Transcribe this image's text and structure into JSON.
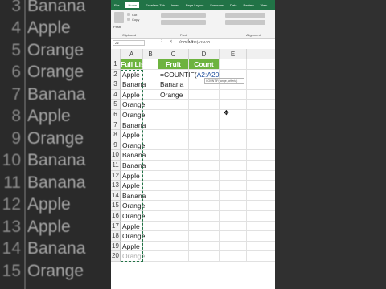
{
  "background_left_rows": [
    {
      "num": "3",
      "text": "Banana"
    },
    {
      "num": "4",
      "text": "Apple"
    },
    {
      "num": "5",
      "text": "Orange"
    },
    {
      "num": "6",
      "text": "Orange"
    },
    {
      "num": "7",
      "text": "Banana"
    },
    {
      "num": "8",
      "text": "Apple"
    },
    {
      "num": "9",
      "text": "Orange"
    },
    {
      "num": "10",
      "text": "Banana"
    },
    {
      "num": "11",
      "text": "Banana"
    },
    {
      "num": "12",
      "text": "Apple"
    },
    {
      "num": "13",
      "text": "Apple"
    },
    {
      "num": "14",
      "text": "Banana"
    },
    {
      "num": "15",
      "text": "Orange"
    }
  ],
  "ribbon": {
    "tabs": [
      "File",
      "Home",
      "Excellent Tab",
      "Insert",
      "Page Layout",
      "Formulas",
      "Data",
      "Review",
      "View"
    ],
    "active_tab": "Home",
    "paste_label": "Paste",
    "cut_label": "Cut",
    "copy_label": "Copy",
    "clipboard_label": "Clipboard",
    "font_label": "Font",
    "alignment_label": "Alignment"
  },
  "formula_bar": {
    "name_box": "A2",
    "formula": "=COUNTIF(A2:A20"
  },
  "columns": [
    "A",
    "B",
    "C",
    "D",
    "E"
  ],
  "rows": [
    "1",
    "2",
    "3",
    "4",
    "5",
    "6",
    "7",
    "8",
    "9",
    "10",
    "11",
    "12",
    "13",
    "14",
    "15",
    "16",
    "17",
    "18",
    "19",
    "20"
  ],
  "sheet": {
    "col_a_header": "Full List",
    "col_c_header": "Fruit",
    "col_d_header": "Count",
    "full_list": [
      "Apple",
      "Banana",
      "Apple",
      "Orange",
      "Orange",
      "Banana",
      "Apple",
      "Orange",
      "Banana",
      "Banana",
      "Apple",
      "Apple",
      "Banana",
      "Orange",
      "Orange",
      "Apple",
      "Orange",
      "Apple",
      "Orange"
    ],
    "fruit_list": [
      "",
      "Banana",
      "Orange"
    ],
    "editing_cell_text": "=COUNTIF(",
    "editing_cell_ref": "A2:A20",
    "tooltip": "COUNTIF(range, criteria)"
  },
  "colors": {
    "excel_green": "#217346",
    "header_fill": "#6db33f"
  }
}
